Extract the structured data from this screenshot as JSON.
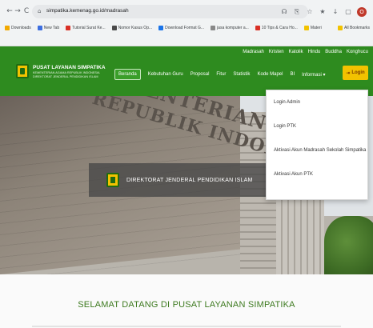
{
  "browser": {
    "url": "simpatika.kemenag.go.id/madrasah",
    "nav": {
      "back": "←",
      "forward": "→",
      "reload": "C"
    },
    "lock_icon": "lock-icon",
    "extensions": [
      "☊",
      "⎘",
      "☆",
      "★",
      "↓",
      "▢"
    ],
    "profile_initial": "O",
    "bookmarks": [
      {
        "label": "Downloads",
        "color": "#f2a900"
      },
      {
        "label": "New Tab",
        "color": "#3c6ee0"
      },
      {
        "label": "Tutorial Surat Ke...",
        "color": "#d93025"
      },
      {
        "label": "Nomor Kasus Op...",
        "color": "#4a4a4a"
      },
      {
        "label": "Download Format G...",
        "color": "#1a73e8"
      },
      {
        "label": "jasa komputer a...",
        "color": "#888888"
      },
      {
        "label": "10 Tips & Cara Ho...",
        "color": "#d93025"
      },
      {
        "label": "Materi",
        "color": "#f2c200"
      },
      {
        "label": "All Bookmarks",
        "color": "#f2c200"
      }
    ]
  },
  "site": {
    "top_links": [
      "Madrasah",
      "Kristen",
      "Katolik",
      "Hindu",
      "Buddha",
      "Konghucu"
    ],
    "logo_title": "PUSAT LAYANAN SIMPATIKA",
    "logo_sub1": "KEMENTERIAN AGAMA REPUBLIK INDONESIA",
    "logo_sub2": "DIREKTORAT JENDERAL PENDIDIKAN ISLAM",
    "nav": [
      "Beranda",
      "Kebutuhan Guru",
      "Proposal",
      "Fitur",
      "Statistik",
      "Kode Mapel",
      "BI",
      "Informasi ▾"
    ],
    "login_label": "Login",
    "login_icon": "sign-in-icon"
  },
  "hero": {
    "building_text1": "KEMENTERIAN AGAMA",
    "building_text2": "REPUBLIK INDONESIA",
    "banner_text": "DIREKTORAT JENDERAL PENDIDIKAN ISLAM"
  },
  "dropdown": {
    "items": [
      "Login Admin",
      "Login PTK",
      "Aktivasi Akun Madrasah Sekolah Simpatika",
      "Aktivasi Akun PTK"
    ]
  },
  "content": {
    "welcome": "SELAMAT DATANG DI PUSAT LAYANAN SIMPATIKA"
  },
  "colors": {
    "header_green": "#2e8b1f",
    "login_yellow": "#f2c200",
    "welcome_green": "#3d7a1f"
  }
}
